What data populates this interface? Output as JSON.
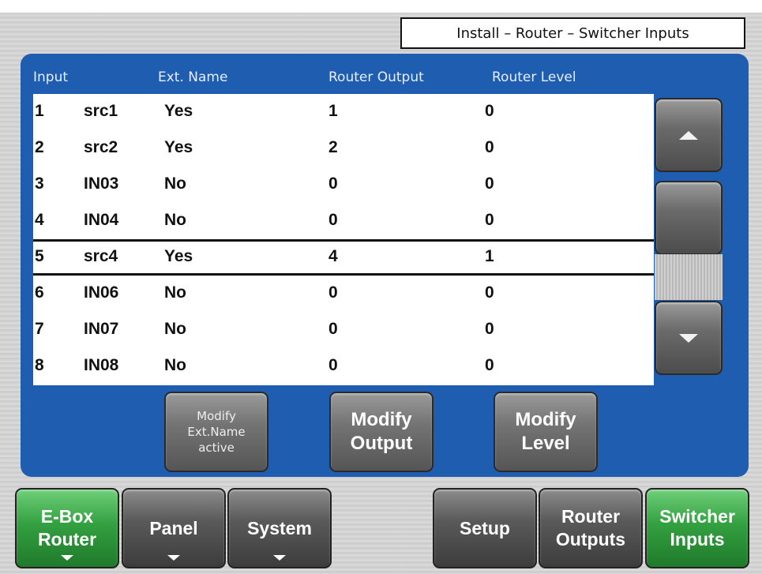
{
  "header": {
    "title": "Install – Router – Switcher Inputs"
  },
  "columns": {
    "input": "Input",
    "ext_name": "Ext. Name",
    "router_output": "Router Output",
    "router_level": "Router Level"
  },
  "rows": [
    {
      "num": "1",
      "src": "src1",
      "ext": "Yes",
      "out": "1",
      "lvl": "0"
    },
    {
      "num": "2",
      "src": "src2",
      "ext": "Yes",
      "out": "2",
      "lvl": "0"
    },
    {
      "num": "3",
      "src": "IN03",
      "ext": "No",
      "out": "0",
      "lvl": "0"
    },
    {
      "num": "4",
      "src": "IN04",
      "ext": "No",
      "out": "0",
      "lvl": "0"
    },
    {
      "num": "5",
      "src": "src4",
      "ext": "Yes",
      "out": "4",
      "lvl": "1"
    },
    {
      "num": "6",
      "src": "IN06",
      "ext": "No",
      "out": "0",
      "lvl": "0"
    },
    {
      "num": "7",
      "src": "IN07",
      "ext": "No",
      "out": "0",
      "lvl": "0"
    },
    {
      "num": "8",
      "src": "IN08",
      "ext": "No",
      "out": "0",
      "lvl": "0"
    }
  ],
  "actions": {
    "modify_ext_name": [
      "Modify",
      "Ext.Name",
      "active"
    ],
    "modify_output": [
      "Modify",
      "Output"
    ],
    "modify_level": [
      "Modify",
      "Level"
    ]
  },
  "nav": {
    "ebox_router": [
      "E-Box",
      "Router"
    ],
    "panel": "Panel",
    "system": "System",
    "setup": "Setup",
    "router_outputs": [
      "Router",
      "Outputs"
    ],
    "switcher_inputs": [
      "Switcher",
      "Inputs"
    ]
  },
  "icons": {
    "scroll_up": "triangle-up-icon",
    "scroll_down": "triangle-down-icon",
    "menu_caret": "caret-down-icon"
  },
  "colors": {
    "panel_blue": "#1f5db0",
    "active_green": "#33a040",
    "button_gray": "#5a5a5a"
  }
}
